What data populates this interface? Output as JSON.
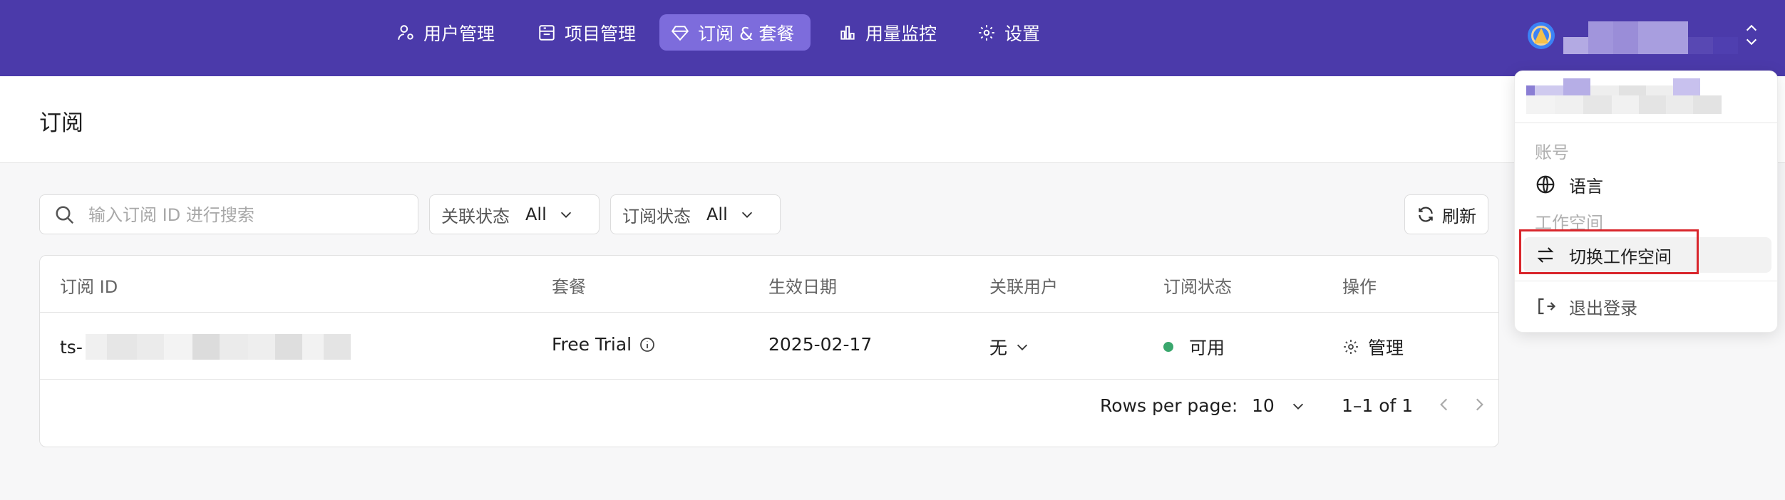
{
  "nav": {
    "items": [
      {
        "label": "用户管理",
        "icon": "user-cog-icon"
      },
      {
        "label": "项目管理",
        "icon": "project-icon"
      },
      {
        "label": "订阅 & 套餐",
        "icon": "gem-icon",
        "active": true
      },
      {
        "label": "用量监控",
        "icon": "bar-chart-icon"
      },
      {
        "label": "设置",
        "icon": "gear-icon"
      }
    ],
    "colors": {
      "bar": "#4b3aaa",
      "active": "#7d6cdc"
    }
  },
  "page": {
    "title": "订阅"
  },
  "filters": {
    "search_placeholder": "输入订阅 ID 进行搜索",
    "link_status_label": "关联状态",
    "link_status_value": "All",
    "sub_status_label": "订阅状态",
    "sub_status_value": "All",
    "refresh_label": "刷新"
  },
  "table": {
    "columns": [
      "订阅 ID",
      "套餐",
      "生效日期",
      "关联用户",
      "订阅状态",
      "操作"
    ],
    "rows": [
      {
        "id_prefix": "ts-",
        "plan": "Free Trial",
        "date": "2025-02-17",
        "user": "无",
        "status": "可用",
        "action": "管理"
      }
    ],
    "status_color": "#3aa76d"
  },
  "pagination": {
    "rows_per_page_label": "Rows per page:",
    "rows_per_page": "10",
    "range": "1–1 of 1"
  },
  "dropdown": {
    "section_account": "账号",
    "language": "语言",
    "section_workspace": "工作空间",
    "switch_workspace": "切换工作空间",
    "logout": "退出登录",
    "highlight_color": "#d9262c"
  }
}
